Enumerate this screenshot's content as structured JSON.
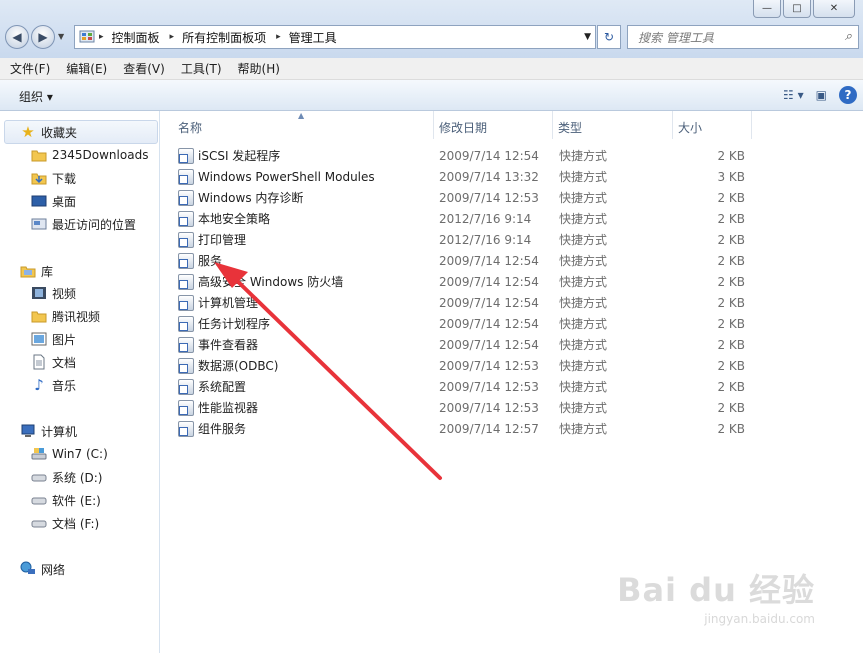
{
  "window": {
    "buttons": [
      "—",
      "□",
      "✕"
    ]
  },
  "address": {
    "crumbs": [
      "控制面板",
      "所有控制面板项",
      "管理工具"
    ]
  },
  "search": {
    "placeholder": "搜索 管理工具"
  },
  "menu": [
    "文件(F)",
    "编辑(E)",
    "查看(V)",
    "工具(T)",
    "帮助(H)"
  ],
  "command_bar": {
    "organize_label": "组织 ▾",
    "help_label": "?"
  },
  "sidebar": {
    "favorites_label": "收藏夹",
    "favorites": [
      "2345Downloads",
      "下载",
      "桌面",
      "最近访问的位置"
    ],
    "libraries_label": "库",
    "libraries": [
      "视频",
      "腾讯视频",
      "图片",
      "文档",
      "音乐"
    ],
    "computer_label": "计算机",
    "drives": [
      "Win7 (C:)",
      "系统 (D:)",
      "软件 (E:)",
      "文档 (F:)"
    ],
    "network_label": "网络"
  },
  "columns": {
    "name": "名称",
    "date": "修改日期",
    "type": "类型",
    "size": "大小"
  },
  "files": [
    {
      "name": "iSCSI 发起程序",
      "date": "2009/7/14 12:54",
      "type": "快捷方式",
      "size": "2 KB"
    },
    {
      "name": "Windows PowerShell Modules",
      "date": "2009/7/14 13:32",
      "type": "快捷方式",
      "size": "3 KB"
    },
    {
      "name": "Windows 内存诊断",
      "date": "2009/7/14 12:53",
      "type": "快捷方式",
      "size": "2 KB"
    },
    {
      "name": "本地安全策略",
      "date": "2012/7/16 9:14",
      "type": "快捷方式",
      "size": "2 KB"
    },
    {
      "name": "打印管理",
      "date": "2012/7/16 9:14",
      "type": "快捷方式",
      "size": "2 KB"
    },
    {
      "name": "服务",
      "date": "2009/7/14 12:54",
      "type": "快捷方式",
      "size": "2 KB"
    },
    {
      "name": "高级安全 Windows 防火墙",
      "date": "2009/7/14 12:54",
      "type": "快捷方式",
      "size": "2 KB"
    },
    {
      "name": "计算机管理",
      "date": "2009/7/14 12:54",
      "type": "快捷方式",
      "size": "2 KB"
    },
    {
      "name": "任务计划程序",
      "date": "2009/7/14 12:54",
      "type": "快捷方式",
      "size": "2 KB"
    },
    {
      "name": "事件查看器",
      "date": "2009/7/14 12:54",
      "type": "快捷方式",
      "size": "2 KB"
    },
    {
      "name": "数据源(ODBC)",
      "date": "2009/7/14 12:53",
      "type": "快捷方式",
      "size": "2 KB"
    },
    {
      "name": "系统配置",
      "date": "2009/7/14 12:53",
      "type": "快捷方式",
      "size": "2 KB"
    },
    {
      "name": "性能监视器",
      "date": "2009/7/14 12:53",
      "type": "快捷方式",
      "size": "2 KB"
    },
    {
      "name": "组件服务",
      "date": "2009/7/14 12:57",
      "type": "快捷方式",
      "size": "2 KB"
    }
  ],
  "watermark": {
    "brand": "Bai du 经验",
    "url": "jingyan.baidu.com"
  },
  "colors": {
    "arrow": "#e8333a",
    "accent": "#2f6bc4"
  }
}
